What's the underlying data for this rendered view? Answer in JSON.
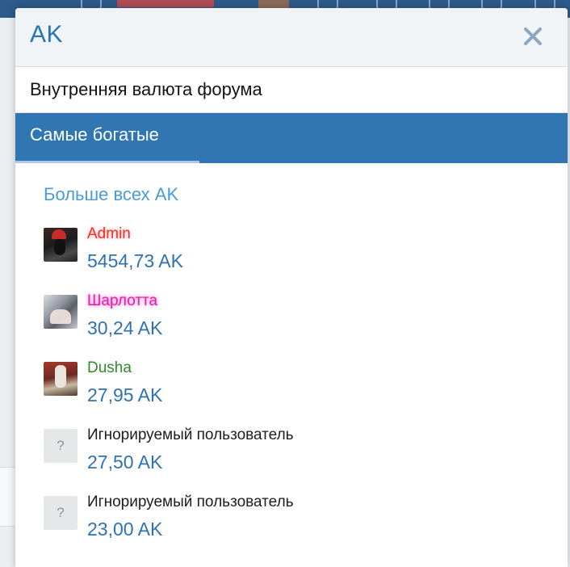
{
  "background": {
    "topbar_color": "#2d5b8a",
    "icons": [
      "lock-icon",
      "mail-icon",
      "bell-icon",
      "lightbulb-icon",
      "pencil-icon",
      "search-icon"
    ]
  },
  "modal": {
    "title": "AK",
    "close_icon": "close-icon",
    "subtitle": "Внутренняя валюта форума",
    "tab": {
      "label": "Самые богатые",
      "active": true
    },
    "section_title": "Больше всех AK",
    "accent_color": "#2f76b3",
    "leaders": [
      {
        "name": "Admin",
        "amount": "5454,73 AK",
        "style": "admin",
        "avatar": "admin",
        "avatar_glyph": ""
      },
      {
        "name": "Шарлотта",
        "amount": "30,24 AK",
        "style": "charlotte",
        "avatar": "charlotte",
        "avatar_glyph": ""
      },
      {
        "name": "Dusha",
        "amount": "27,95 AK",
        "style": "dusha",
        "avatar": "dusha",
        "avatar_glyph": ""
      },
      {
        "name": "Игнорируемый пользователь",
        "amount": "27,50 AK",
        "style": "ignored",
        "avatar": "placeholder",
        "avatar_glyph": "?"
      },
      {
        "name": "Игнорируемый пользователь",
        "amount": "23,00 AK",
        "style": "ignored",
        "avatar": "placeholder",
        "avatar_glyph": "?"
      }
    ]
  }
}
